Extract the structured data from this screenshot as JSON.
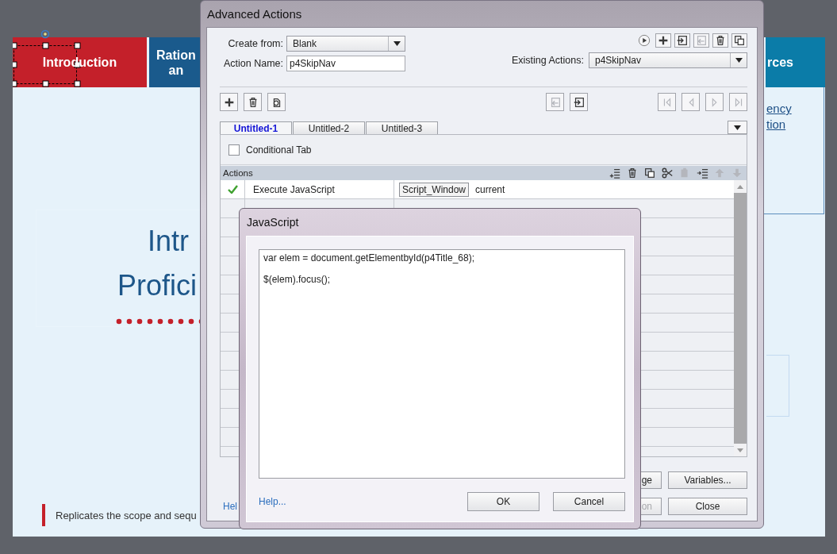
{
  "slide": {
    "nav_tabs": [
      {
        "lines": [
          "Introduction"
        ],
        "color": "#c4202a"
      },
      {
        "lines": [
          "Ration",
          "an"
        ],
        "color": "#1a5a8c"
      },
      {
        "lines": [
          "rces"
        ],
        "color": "#0b7ca8"
      }
    ],
    "title_lines": [
      "Intr",
      "Profici"
    ],
    "link_lines": [
      "ency",
      "tion"
    ],
    "caption": "Replicates the scope and sequ"
  },
  "advanced_actions": {
    "title": "Advanced Actions",
    "create_from": {
      "label": "Create from:",
      "value": "Blank"
    },
    "action_name": {
      "label": "Action Name:",
      "value": "p4SkipNav"
    },
    "existing_actions": {
      "label": "Existing Actions:",
      "value": "p4SkipNav"
    },
    "top_icons": [
      {
        "kind": "play",
        "disabled": false
      },
      {
        "kind": "plus",
        "disabled": false
      },
      {
        "kind": "import",
        "disabled": false
      },
      {
        "kind": "export",
        "disabled": true
      },
      {
        "kind": "trash",
        "disabled": false
      },
      {
        "kind": "copy",
        "disabled": false
      }
    ],
    "toolbar_left": [
      {
        "kind": "plus",
        "disabled": false
      },
      {
        "kind": "trash",
        "disabled": false
      },
      {
        "kind": "duplicate",
        "disabled": false
      }
    ],
    "toolbar_center": [
      {
        "kind": "export",
        "disabled": true
      },
      {
        "kind": "import",
        "disabled": false
      }
    ],
    "toolbar_right": [
      {
        "kind": "first",
        "disabled": true
      },
      {
        "kind": "prev",
        "disabled": true
      },
      {
        "kind": "next",
        "disabled": true
      },
      {
        "kind": "last",
        "disabled": true
      }
    ],
    "tabs": [
      {
        "label": "Untitled-1",
        "selected": true
      },
      {
        "label": "Untitled-2",
        "selected": false
      },
      {
        "label": "Untitled-3",
        "selected": false
      }
    ],
    "conditional_tab": {
      "label": "Conditional Tab",
      "checked": false
    },
    "actions_header": "Actions",
    "header_icons": [
      {
        "kind": "add-row",
        "disabled": false
      },
      {
        "kind": "trash",
        "disabled": false
      },
      {
        "kind": "copy",
        "disabled": false
      },
      {
        "kind": "cut",
        "disabled": false
      },
      {
        "kind": "paste",
        "disabled": true
      },
      {
        "kind": "insert-row",
        "disabled": false
      },
      {
        "kind": "up",
        "disabled": true
      },
      {
        "kind": "down",
        "disabled": true
      }
    ],
    "rows": [
      {
        "enabled": true,
        "action": "Execute JavaScript",
        "target": "Script_Window",
        "option": "current"
      }
    ],
    "help": "Hel",
    "buttons": [
      [
        {
          "label": "ge",
          "disabled": false
        },
        {
          "label": "Variables...",
          "disabled": false
        }
      ],
      [
        {
          "label": "on",
          "disabled": true
        },
        {
          "label": "Close",
          "disabled": false
        }
      ]
    ]
  },
  "javascript_dialog": {
    "title": "JavaScript",
    "code_lines": [
      "var elem = document.getElementbyId(p4Title_68);",
      "$(elem).focus();"
    ],
    "help": "Help...",
    "buttons": [
      "OK",
      "Cancel"
    ]
  }
}
